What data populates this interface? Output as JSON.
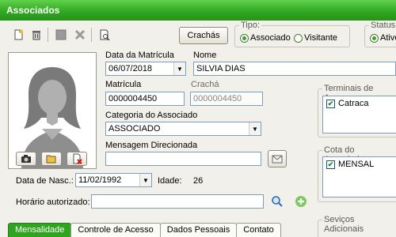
{
  "window": {
    "title": "Associados"
  },
  "toolbar": {
    "icons": [
      "new-icon",
      "delete-icon",
      "save-icon",
      "cancel-icon",
      "print-preview-icon"
    ],
    "crachas_label": "Crachás"
  },
  "tipo": {
    "label": "Tipo:",
    "options": [
      "Associado",
      "Visitante"
    ],
    "selected": "Associado"
  },
  "status": {
    "label": "Status:",
    "selected_label": "Ativo"
  },
  "form": {
    "data_matricula_label": "Data da Matrícula",
    "data_matricula_value": "06/07/2018",
    "nome_label": "Nome",
    "nome_value": "SILVIA DIAS",
    "matricula_label": "Matrícula",
    "matricula_value": "0000004450",
    "cracha_label": "Crachá",
    "cracha_value": "0000004450",
    "categoria_label": "Categoria do Associado",
    "categoria_value": "ASSOCIADO",
    "mensagem_label": "Mensagem Direcionada",
    "mensagem_value": "",
    "nascimento_label": "Data de Nasc.:",
    "nascimento_value": "11/02/1992",
    "idade_label": "Idade:",
    "idade_value": "26",
    "horario_label": "Horário autorizado:",
    "horario_value": ""
  },
  "terminais": {
    "label": "Terminais de Acesso",
    "items": [
      {
        "label": "Catraca",
        "checked": true
      }
    ]
  },
  "cota": {
    "label": "Cota do Associado",
    "items": [
      {
        "label": "MENSAL",
        "checked": true
      }
    ]
  },
  "servicos": {
    "label": "Seviços Adicionais"
  },
  "tabs": [
    {
      "label": "Mensalidade",
      "active": true
    },
    {
      "label": "Controle de Acesso",
      "active": false
    },
    {
      "label": "Dados Pessoais",
      "active": false
    },
    {
      "label": "Contato",
      "active": false
    }
  ],
  "colors": {
    "title_green": "#2fa51f",
    "accent_green": "#35a52b"
  }
}
